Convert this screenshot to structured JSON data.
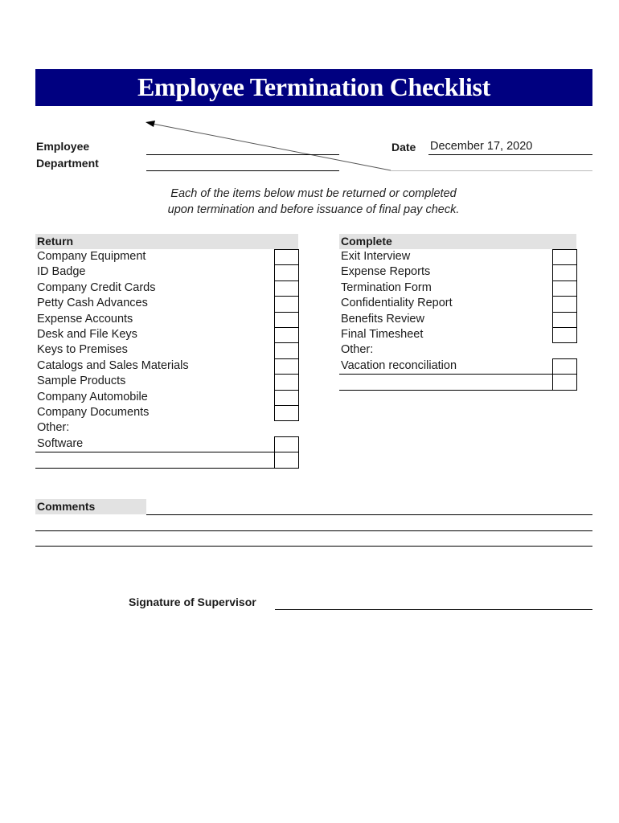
{
  "title": "Employee Termination Checklist",
  "header_fields": {
    "employee_label": "Employee",
    "employee_value": "",
    "department_label": "Department",
    "department_value": "",
    "date_label": "Date",
    "date_value": "December 17, 2020"
  },
  "instructions": {
    "line1": "Each of the items below must be returned or completed",
    "line2": "upon termination and before issuance of final pay check."
  },
  "return_section": {
    "heading": "Return",
    "items": [
      {
        "label": "Company Equipment",
        "checked": false
      },
      {
        "label": "ID Badge",
        "checked": false
      },
      {
        "label": "Company Credit Cards",
        "checked": false
      },
      {
        "label": "Petty Cash Advances",
        "checked": false
      },
      {
        "label": "Expense Accounts",
        "checked": false
      },
      {
        "label": "Desk and File Keys",
        "checked": false
      },
      {
        "label": "Keys to Premises",
        "checked": false
      },
      {
        "label": "Catalogs and Sales Materials",
        "checked": false
      },
      {
        "label": "Sample Products",
        "checked": false
      },
      {
        "label": "Company Automobile",
        "checked": false
      },
      {
        "label": "Company Documents",
        "checked": false
      }
    ],
    "other_label": "Other:",
    "other_items": [
      {
        "label": "Software",
        "checked": false
      },
      {
        "label": "",
        "checked": false
      }
    ]
  },
  "complete_section": {
    "heading": "Complete",
    "items": [
      {
        "label": "Exit Interview",
        "checked": false
      },
      {
        "label": "Expense Reports",
        "checked": false
      },
      {
        "label": "Termination Form",
        "checked": false
      },
      {
        "label": "Confidentiality Report",
        "checked": false
      },
      {
        "label": "Benefits Review",
        "checked": false
      },
      {
        "label": "Final Timesheet",
        "checked": false
      }
    ],
    "other_label": "Other:",
    "other_items": [
      {
        "label": "Vacation reconciliation",
        "checked": false
      },
      {
        "label": "",
        "checked": false
      }
    ]
  },
  "comments": {
    "label": "Comments",
    "lines": [
      "",
      "",
      ""
    ]
  },
  "signature": {
    "label": "Signature of Supervisor",
    "value": ""
  },
  "colors": {
    "banner": "#000080",
    "section_header_bg": "#e2e2e2"
  }
}
